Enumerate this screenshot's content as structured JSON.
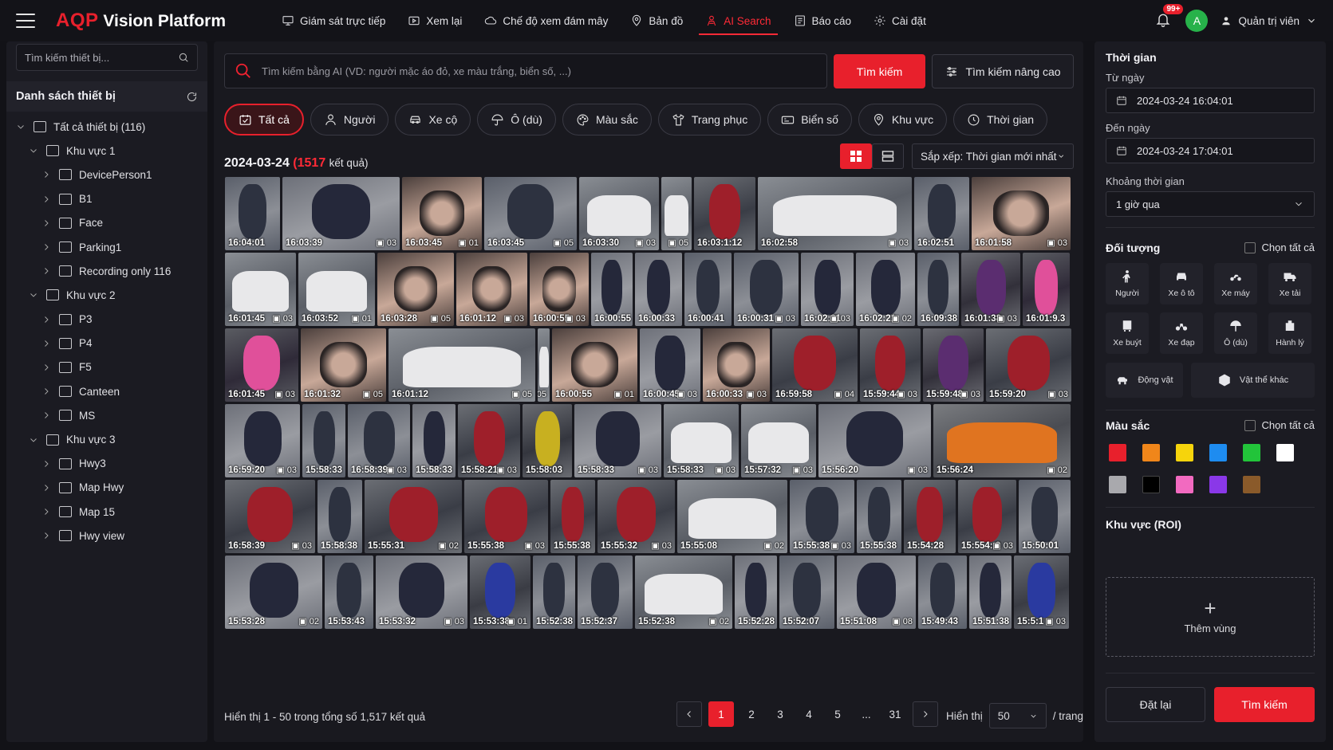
{
  "app": {
    "brand": "AQP",
    "title": "Vision Platform"
  },
  "nav": [
    {
      "label": "Giám sát trực tiếp",
      "icon": "monitor-icon"
    },
    {
      "label": "Xem lại",
      "icon": "playback-icon"
    },
    {
      "label": "Chế độ xem đám mây",
      "icon": "cloud-icon"
    },
    {
      "label": "Bản đồ",
      "icon": "map-pin-icon"
    },
    {
      "label": "AI Search",
      "icon": "ai-person-icon",
      "active": true
    },
    {
      "label": "Báo cáo",
      "icon": "report-icon"
    },
    {
      "label": "Cài đặt",
      "icon": "gear-icon"
    }
  ],
  "topbar": {
    "notif_count": "99+",
    "avatar_letter": "A",
    "user": "Quản trị viên"
  },
  "sidebar": {
    "search_placeholder": "Tìm kiếm thiết bị...",
    "heading": "Danh sách thiết bị",
    "tree": [
      {
        "label": "Tất cả thiết bị (116)",
        "level": 0,
        "expanded": true
      },
      {
        "label": "Khu vực 1",
        "level": 1,
        "expanded": true
      },
      {
        "label": "DevicePerson1",
        "level": 2
      },
      {
        "label": "B1",
        "level": 2
      },
      {
        "label": "Face",
        "level": 2
      },
      {
        "label": "Parking1",
        "level": 2
      },
      {
        "label": "Recording only 116",
        "level": 2
      },
      {
        "label": "Khu vực 2",
        "level": 1,
        "expanded": true
      },
      {
        "label": "P3",
        "level": 2
      },
      {
        "label": "P4",
        "level": 2
      },
      {
        "label": "F5",
        "level": 2
      },
      {
        "label": "Canteen",
        "level": 2
      },
      {
        "label": "MS",
        "level": 2
      },
      {
        "label": "Khu vực 3",
        "level": 1,
        "expanded": true
      },
      {
        "label": "Hwy3",
        "level": 2
      },
      {
        "label": "Map Hwy",
        "level": 2
      },
      {
        "label": "Map 15",
        "level": 2
      },
      {
        "label": "Hwy view",
        "level": 2
      }
    ]
  },
  "search": {
    "placeholder": "Tìm kiếm bằng AI (VD: người mặc áo đỏ, xe màu trắng, biển số, ...)",
    "button": "Tìm kiếm",
    "advanced": "Tìm kiếm nâng cao"
  },
  "filters": [
    {
      "label": "Tất cả",
      "icon": "all-icon",
      "active": true
    },
    {
      "label": "Người",
      "icon": "person-icon"
    },
    {
      "label": "Xe cộ",
      "icon": "car-icon"
    },
    {
      "label": "Ô (dù)",
      "icon": "umbrella-icon"
    },
    {
      "label": "Màu sắc",
      "icon": "palette-icon"
    },
    {
      "label": "Trang phục",
      "icon": "shirt-icon"
    },
    {
      "label": "Biển số",
      "icon": "plate-icon"
    },
    {
      "label": "Khu vực",
      "icon": "location-icon"
    },
    {
      "label": "Thời gian",
      "icon": "clock-icon"
    }
  ],
  "results": {
    "date": "2024-03-24",
    "count": "1517",
    "count_suffix": "kết quả",
    "sort": "Sắp xếp: Thời gian mới nhất"
  },
  "grid": [
    [
      {
        "t": "16:04:01",
        "c": "",
        "w": 0.9,
        "k": "person"
      },
      {
        "t": "16:03:39",
        "c": "03",
        "w": 1.9,
        "k": "moto"
      },
      {
        "t": "16:03:45",
        "c": "01",
        "w": 1.3,
        "k": "face"
      },
      {
        "t": "16:03:45",
        "c": "05",
        "w": 1.5,
        "k": "person"
      },
      {
        "t": "16:03:30",
        "c": "03",
        "w": 1.3,
        "k": "car"
      },
      {
        "t": "",
        "c": "05",
        "w": 0.5,
        "k": "car"
      },
      {
        "t": "16:03:1:12",
        "c": "",
        "w": 1.0,
        "k": "red"
      },
      {
        "t": "16:02:58",
        "c": "03",
        "w": 2.5,
        "k": "car"
      },
      {
        "t": "16:02:51",
        "c": "",
        "w": 0.9,
        "k": "person"
      },
      {
        "t": "16:01:58",
        "c": "03",
        "w": 1.6,
        "k": "face"
      }
    ],
    [
      {
        "t": "16:01:45",
        "c": "03",
        "w": 1.2,
        "k": "car"
      },
      {
        "t": "16:03:52",
        "c": "01",
        "w": 1.3,
        "k": "car"
      },
      {
        "t": "16:03:28",
        "c": "05",
        "w": 1.3,
        "k": "face"
      },
      {
        "t": "16:01:12",
        "c": "03",
        "w": 1.2,
        "k": "face"
      },
      {
        "t": "16:00:55",
        "c": "03",
        "w": 1.0,
        "k": "face"
      },
      {
        "t": "16:00:55",
        "c": "",
        "w": 0.7,
        "k": "moto"
      },
      {
        "t": "16:00:33",
        "c": "",
        "w": 0.8,
        "k": "moto"
      },
      {
        "t": "16:00:41",
        "c": "",
        "w": 0.8,
        "k": "person"
      },
      {
        "t": "16:00:31",
        "c": "03",
        "w": 1.1,
        "k": "person"
      },
      {
        "t": "16:02:31",
        "c": "03",
        "w": 0.9,
        "k": "moto"
      },
      {
        "t": "16:02:21",
        "c": "02",
        "w": 1.0,
        "k": "moto"
      },
      {
        "t": "16:09:38",
        "c": "",
        "w": 0.7,
        "k": "person"
      },
      {
        "t": "16:01:38",
        "c": "03",
        "w": 1.0,
        "k": "purple"
      },
      {
        "t": "16:01:9.3",
        "c": "",
        "w": 0.8,
        "k": "pink"
      }
    ],
    [
      {
        "t": "16:01:45",
        "c": "03",
        "w": 1.2,
        "k": "pink"
      },
      {
        "t": "16:01:32",
        "c": "05",
        "w": 1.4,
        "k": "face"
      },
      {
        "t": "16:01:12",
        "c": "05",
        "w": 2.4,
        "k": "car"
      },
      {
        "t": "",
        "c": "05",
        "w": 0.2,
        "k": "car"
      },
      {
        "t": "16:00:55",
        "c": "01",
        "w": 1.4,
        "k": "face"
      },
      {
        "t": "16:00:45",
        "c": "03",
        "w": 1.0,
        "k": "moto"
      },
      {
        "t": "16:00:33",
        "c": "03",
        "w": 1.1,
        "k": "face"
      },
      {
        "t": "16:59:58",
        "c": "04",
        "w": 1.4,
        "k": "red"
      },
      {
        "t": "15:59:44",
        "c": "03",
        "w": 1.0,
        "k": "red"
      },
      {
        "t": "15:59:48",
        "c": "03",
        "w": 1.0,
        "k": "purple"
      },
      {
        "t": "15:59:20",
        "c": "03",
        "w": 1.4,
        "k": "red"
      }
    ],
    [
      {
        "t": "16:59:20",
        "c": "03",
        "w": 1.2,
        "k": "moto"
      },
      {
        "t": "15:58:33",
        "c": "",
        "w": 0.7,
        "k": "person"
      },
      {
        "t": "16:58:39",
        "c": "03",
        "w": 1.0,
        "k": "person"
      },
      {
        "t": "15:58:33",
        "c": "",
        "w": 0.7,
        "k": "moto"
      },
      {
        "t": "15:58:21",
        "c": "03",
        "w": 1.0,
        "k": "red"
      },
      {
        "t": "15:58:03",
        "c": "",
        "w": 0.8,
        "k": "yellow"
      },
      {
        "t": "15:58:33",
        "c": "03",
        "w": 1.4,
        "k": "moto"
      },
      {
        "t": "15:58:33",
        "c": "03",
        "w": 1.2,
        "k": "car"
      },
      {
        "t": "15:57:32",
        "c": "03",
        "w": 1.2,
        "k": "car"
      },
      {
        "t": "15:56:20",
        "c": "03",
        "w": 1.8,
        "k": "moto"
      },
      {
        "t": "15:56:24",
        "c": "02",
        "w": 2.2,
        "k": "orange"
      }
    ],
    [
      {
        "t": "16:58:39",
        "c": "03",
        "w": 1.4,
        "k": "red"
      },
      {
        "t": "15:58:38",
        "c": "",
        "w": 0.7,
        "k": "person"
      },
      {
        "t": "15:55:31",
        "c": "02",
        "w": 1.5,
        "k": "red"
      },
      {
        "t": "15:55:38",
        "c": "03",
        "w": 1.3,
        "k": "red"
      },
      {
        "t": "15:55:38",
        "c": "",
        "w": 0.7,
        "k": "red"
      },
      {
        "t": "15:55:32",
        "c": "03",
        "w": 1.2,
        "k": "red"
      },
      {
        "t": "15:55:08",
        "c": "02",
        "w": 1.7,
        "k": "car"
      },
      {
        "t": "15:55:38",
        "c": "03",
        "w": 1.0,
        "k": "person"
      },
      {
        "t": "15:55:38",
        "c": "",
        "w": 0.7,
        "k": "person"
      },
      {
        "t": "15:54:28",
        "c": "",
        "w": 0.8,
        "k": "red"
      },
      {
        "t": "15:554:.3",
        "c": "03",
        "w": 0.9,
        "k": "red"
      },
      {
        "t": "15:50:01",
        "c": "",
        "w": 0.8,
        "k": "person"
      }
    ],
    [
      {
        "t": "15:53:28",
        "c": "02",
        "w": 1.6,
        "k": "moto"
      },
      {
        "t": "15:53:43",
        "c": "",
        "w": 0.8,
        "k": "person"
      },
      {
        "t": "15:53:32",
        "c": "03",
        "w": 1.5,
        "k": "moto"
      },
      {
        "t": "15:53:38",
        "c": "01",
        "w": 1.0,
        "k": "blue"
      },
      {
        "t": "15:52:38",
        "c": "",
        "w": 0.7,
        "k": "person"
      },
      {
        "t": "15:52:37",
        "c": "",
        "w": 0.9,
        "k": "person"
      },
      {
        "t": "15:52:38",
        "c": "02",
        "w": 1.6,
        "k": "car"
      },
      {
        "t": "15:52:28",
        "c": "",
        "w": 0.7,
        "k": "moto"
      },
      {
        "t": "15:52:07",
        "c": "",
        "w": 0.9,
        "k": "person"
      },
      {
        "t": "15:51:08",
        "c": "08",
        "w": 1.3,
        "k": "moto"
      },
      {
        "t": "15:49:43",
        "c": "",
        "w": 0.8,
        "k": "person"
      },
      {
        "t": "15:51:38",
        "c": "",
        "w": 0.7,
        "k": "moto"
      },
      {
        "t": "15:5:1",
        "c": "03",
        "w": 0.9,
        "k": "blue"
      }
    ]
  ],
  "pagination": {
    "info": "Hiển thị 1 - 50 trong tổng số 1,517 kết quả",
    "pages": [
      "1",
      "2",
      "3",
      "4",
      "5",
      "...",
      "31"
    ],
    "active": "1",
    "show_label": "Hiển thị",
    "per_page": "50",
    "per_page_suffix": "/ trang"
  },
  "right": {
    "time_title": "Thời gian",
    "from_label": "Từ ngày",
    "from_value": "2024-03-24 16:04:01",
    "to_label": "Đến ngày",
    "to_value": "2024-03-24 17:04:01",
    "range_label": "Khoảng thời gian",
    "range_value": "1 giờ qua",
    "object_title": "Đối tượng",
    "select_all": "Chọn tất cả",
    "objects": [
      {
        "label": "Người",
        "icon": "person-icon"
      },
      {
        "label": "Xe ô tô",
        "icon": "car-icon"
      },
      {
        "label": "Xe máy",
        "icon": "motorbike-icon"
      },
      {
        "label": "Xe tải",
        "icon": "truck-icon"
      },
      {
        "label": "Xe buýt",
        "icon": "bus-icon"
      },
      {
        "label": "Xe đạp",
        "icon": "bicycle-icon"
      },
      {
        "label": "Ô (dù)",
        "icon": "umbrella-icon"
      },
      {
        "label": "Hành lý",
        "icon": "luggage-icon"
      }
    ],
    "objects_wide": [
      {
        "label": "Động vật",
        "icon": "animal-icon"
      },
      {
        "label": "Vật thể khác",
        "icon": "box-icon"
      }
    ],
    "color_title": "Màu sắc",
    "colors": [
      "#e8202c",
      "#f0861a",
      "#f6d40c",
      "#1e8cf0",
      "#22c43a",
      "#ffffff",
      "#a9a9ad",
      "#000000",
      "#f26ac0",
      "#8a38e8",
      "#8a5a2a"
    ],
    "roi_title": "Khu vực (ROI)",
    "roi_add": "Thêm vùng",
    "reset": "Đặt lại",
    "search": "Tìm kiếm"
  }
}
